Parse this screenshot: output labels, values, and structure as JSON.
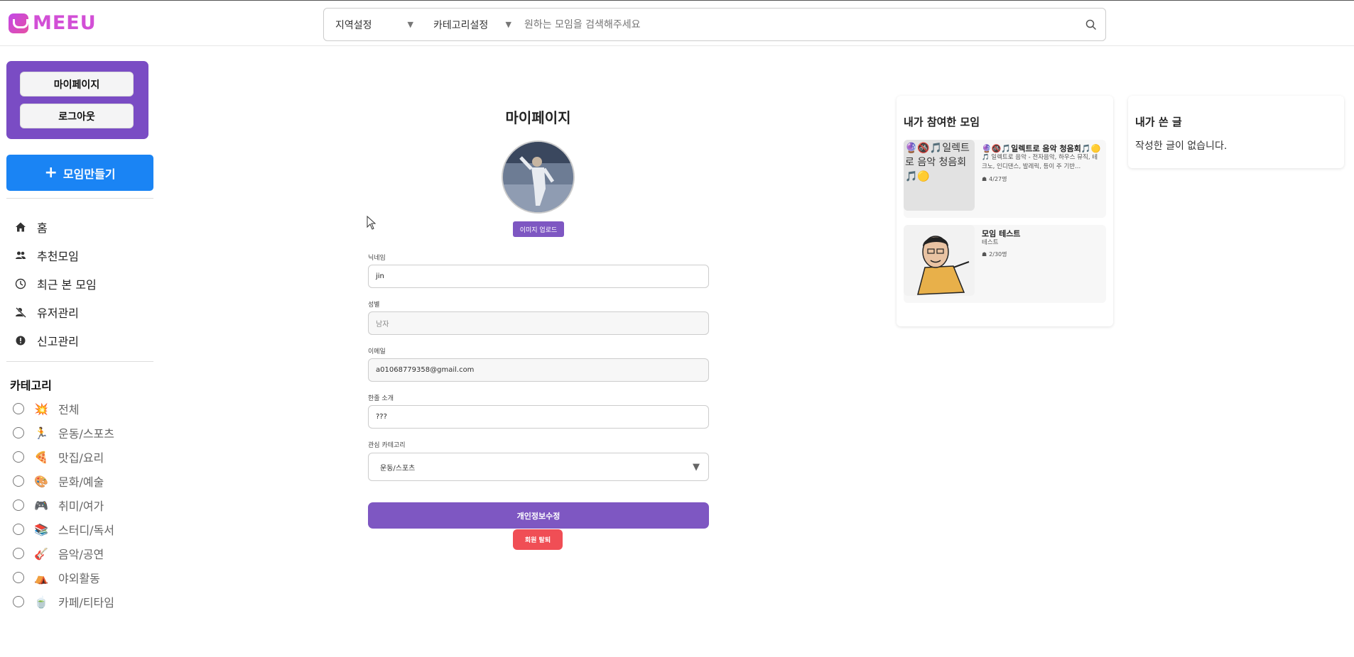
{
  "header": {
    "logo_text": "MEEU",
    "region_select": "지역설정",
    "category_select": "카테고리설정",
    "search_placeholder": "원하는 모임을 검색해주세요"
  },
  "sidebar": {
    "mypage_label": "마이페이지",
    "logout_label": "로그아웃",
    "create_label": "모임만들기",
    "nav": [
      {
        "label": "홈",
        "icon": "home-icon"
      },
      {
        "label": "추천모임",
        "icon": "people-icon"
      },
      {
        "label": "최근 본 모임",
        "icon": "clock-icon"
      },
      {
        "label": "유저관리",
        "icon": "user-off-icon"
      },
      {
        "label": "신고관리",
        "icon": "alert-icon"
      }
    ],
    "category_title": "카테고리",
    "categories": [
      {
        "label": "전체",
        "emoji": "💥"
      },
      {
        "label": "운동/스포츠",
        "emoji": "🏃"
      },
      {
        "label": "맛집/요리",
        "emoji": "🍕"
      },
      {
        "label": "문화/예술",
        "emoji": "🎨"
      },
      {
        "label": "취미/여가",
        "emoji": "🎮"
      },
      {
        "label": "스터디/독서",
        "emoji": "📚"
      },
      {
        "label": "음악/공연",
        "emoji": "🎸"
      },
      {
        "label": "야외활동",
        "emoji": "⛺"
      },
      {
        "label": "카페/티타임",
        "emoji": "🍵"
      }
    ]
  },
  "profile": {
    "title": "마이페이지",
    "upload_label": "이미지 업로드",
    "nickname_label": "닉네임",
    "nickname_value": "jin",
    "gender_label": "성별",
    "gender_value": "남자",
    "email_label": "이메일",
    "email_value": "a01068779358@gmail.com",
    "intro_label": "한줄 소개",
    "intro_value": "???",
    "interest_label": "관심 카테고리",
    "interest_value": "운동/스포츠",
    "submit_label": "개인정보수정",
    "withdraw_label": "회원 탈퇴"
  },
  "joined": {
    "title": "내가 참여한 모임",
    "meetings": [
      {
        "thumb_alt": "🔮🚳🎵일렉트로 음악 청음회🎵🟡",
        "title": "🔮🚳🎵일렉트로 음악 청음회🎵🟡",
        "desc": "🎵 일렉트로 음악 - 전자음악, 하우스 뮤직, 테크노, 인디댄스, 발레릭, 등이 주 기반...",
        "count": "4/27명"
      },
      {
        "title": "모임 테스트",
        "desc": "테스트",
        "count": "2/30명"
      }
    ]
  },
  "posts": {
    "title": "내가 쓴 글",
    "empty": "작성한 글이 없습니다."
  }
}
